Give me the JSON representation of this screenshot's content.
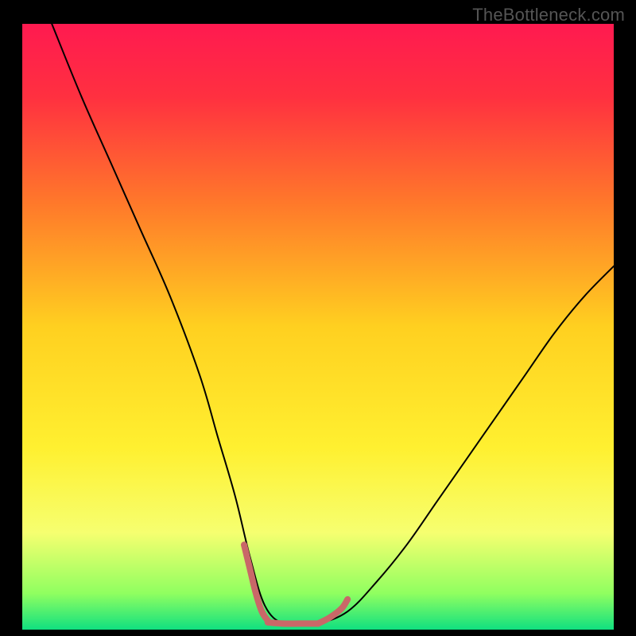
{
  "watermark": "TheBottleneck.com",
  "chart_data": {
    "type": "line",
    "title": "",
    "xlabel": "",
    "ylabel": "",
    "xlim": [
      0,
      100
    ],
    "ylim": [
      0,
      100
    ],
    "background_gradient": {
      "type": "vertical",
      "stops": [
        {
          "pos": 0.0,
          "color": "#ff1a50"
        },
        {
          "pos": 0.12,
          "color": "#ff3040"
        },
        {
          "pos": 0.3,
          "color": "#ff7a2a"
        },
        {
          "pos": 0.5,
          "color": "#ffd020"
        },
        {
          "pos": 0.7,
          "color": "#fff030"
        },
        {
          "pos": 0.84,
          "color": "#f6ff70"
        },
        {
          "pos": 0.94,
          "color": "#90ff60"
        },
        {
          "pos": 1.0,
          "color": "#10e080"
        }
      ]
    },
    "series": [
      {
        "name": "curve",
        "color": "#000000",
        "width": 2,
        "x": [
          5,
          10,
          15,
          20,
          25,
          30,
          33,
          36,
          38.5,
          41,
          44,
          47,
          50,
          55,
          60,
          65,
          70,
          75,
          80,
          85,
          90,
          95,
          100
        ],
        "values": [
          100,
          88,
          77,
          66,
          55,
          42,
          32,
          22,
          12,
          4,
          1,
          1,
          1,
          3,
          8,
          14,
          21,
          28,
          35,
          42,
          49,
          55,
          60
        ]
      },
      {
        "name": "highlight-left",
        "color": "#c96868",
        "width": 8,
        "x": [
          37.5,
          38.5,
          39.5,
          40.5,
          41.5
        ],
        "values": [
          14,
          10,
          6,
          3,
          1.5
        ]
      },
      {
        "name": "highlight-bottom",
        "color": "#c96868",
        "width": 8,
        "x": [
          41.5,
          44,
          47,
          50
        ],
        "values": [
          1.2,
          1,
          1,
          1
        ]
      },
      {
        "name": "highlight-right",
        "color": "#c96868",
        "width": 8,
        "x": [
          50,
          52,
          54,
          55
        ],
        "values": [
          1,
          2,
          3.5,
          5
        ]
      }
    ]
  }
}
